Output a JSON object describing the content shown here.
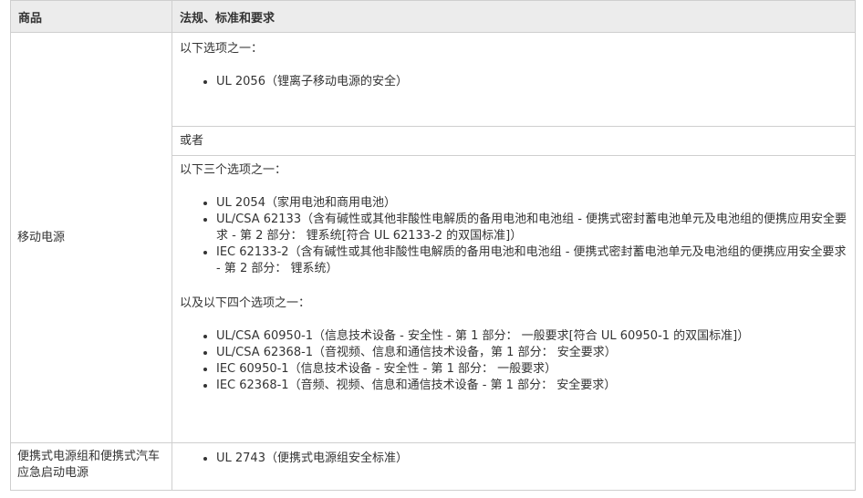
{
  "table": {
    "headers": {
      "product": "商品",
      "regulations": "法规、标准和要求"
    },
    "rows": [
      {
        "product": "移动电源",
        "block1": {
          "intro": "以下选项之一：",
          "items": [
            "UL 2056（锂离子移动电源的安全）"
          ]
        },
        "or_label": "或者",
        "block2": {
          "intro": "以下三个选项之一：",
          "items": [
            "UL 2054（家用电池和商用电池）",
            "UL/CSA 62133（含有碱性或其他非酸性电解质的备用电池和电池组 - 便携式密封蓄电池单元及电池组的便携应用安全要求 - 第 2 部分： 锂系统[符合 UL 62133-2 的双国标准]）",
            "IEC 62133-2（含有碱性或其他非酸性电解质的备用电池和电池组 - 便携式密封蓄电池单元及电池组的便携应用安全要求 - 第 2 部分： 锂系统）"
          ],
          "intro2": "以及以下四个选项之一：",
          "items2": [
            "UL/CSA 60950-1（信息技术设备 - 安全性 - 第 1 部分： 一般要求[符合 UL 60950-1 的双国标准]）",
            "UL/CSA 62368-1（音视频、信息和通信技术设备，第 1 部分： 安全要求）",
            "IEC 60950-1（信息技术设备 - 安全性 - 第 1 部分： 一般要求）",
            "IEC 62368-1（音频、视频、信息和通信技术设备 - 第 1 部分： 安全要求）"
          ]
        }
      },
      {
        "product": "便携式电源组和便携式汽车应急启动电源",
        "items": [
          "UL 2743（便携式电源组安全标准）"
        ]
      }
    ]
  }
}
